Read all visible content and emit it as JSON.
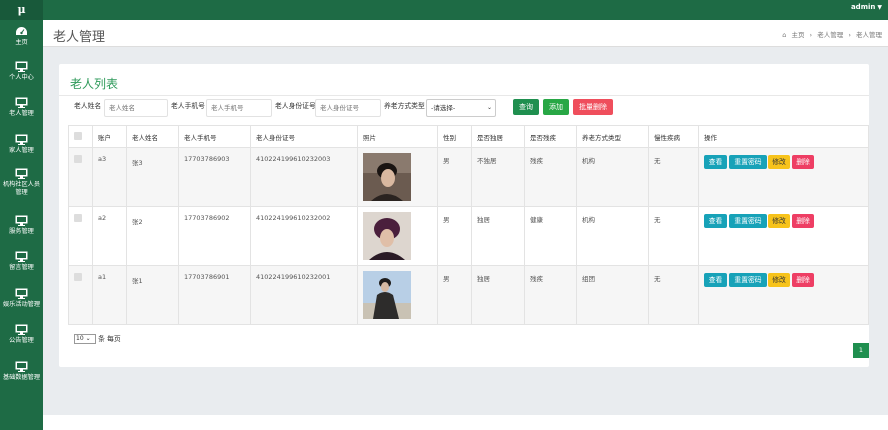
{
  "app": {
    "logo": "μ",
    "user": "admin"
  },
  "sidebar": {
    "items": [
      {
        "label": "主页",
        "icon": "dashboard-icon"
      },
      {
        "label": "个人中心",
        "icon": "monitor-icon"
      },
      {
        "label": "老人管理",
        "icon": "monitor-icon"
      },
      {
        "label": "家人管理",
        "icon": "monitor-icon"
      },
      {
        "label": "机构社区人员管理",
        "icon": "monitor-icon"
      },
      {
        "label": "服务管理",
        "icon": "monitor-icon"
      },
      {
        "label": "留言管理",
        "icon": "monitor-icon"
      },
      {
        "label": "娱乐活动管理",
        "icon": "monitor-icon"
      },
      {
        "label": "公告管理",
        "icon": "monitor-icon"
      },
      {
        "label": "基础数据管理",
        "icon": "monitor-icon"
      }
    ]
  },
  "header": {
    "title": "老人管理",
    "breadcrumb": [
      "主页",
      "老人管理",
      "老人管理"
    ]
  },
  "card": {
    "title": "老人列表"
  },
  "filters": {
    "name_label": "老人姓名",
    "name_placeholder": "老人姓名",
    "phone_label": "老人手机号",
    "phone_placeholder": "老人手机号",
    "id_label": "老人身份证号",
    "id_placeholder": "老人身份证号",
    "care_label": "养老方式类型",
    "care_selected": "-请选择-"
  },
  "buttons": {
    "search": "查询",
    "add": "添加",
    "batch_delete": "批量删除"
  },
  "table": {
    "headers": [
      "账户",
      "老人姓名",
      "老人手机号",
      "老人身份证号",
      "照片",
      "性别",
      "是否独居",
      "是否残疾",
      "养老方式类型",
      "慢性疾病",
      "操作"
    ],
    "rows": [
      {
        "account": "a3",
        "name": "张3",
        "phone": "17703786903",
        "idcard": "410224199610232003",
        "gender": "男",
        "alone": "不独居",
        "disabled": "残疾",
        "care": "机构",
        "chronic": "无"
      },
      {
        "account": "a2",
        "name": "张2",
        "phone": "17703786902",
        "idcard": "410224199610232002",
        "gender": "男",
        "alone": "独居",
        "disabled": "健康",
        "care": "机构",
        "chronic": "无"
      },
      {
        "account": "a1",
        "name": "张1",
        "phone": "17703786901",
        "idcard": "410224199610232001",
        "gender": "男",
        "alone": "独居",
        "disabled": "残疾",
        "care": "组团",
        "chronic": "无"
      }
    ],
    "actions": {
      "view": "查看",
      "reset": "重置密码",
      "edit": "修改",
      "delete": "删除"
    }
  },
  "pagination": {
    "per_page": "10",
    "per_page_suffix": "条 每页",
    "current": "1"
  },
  "colors": {
    "brand": "#1e6b45",
    "accent": "#2e9a5a",
    "danger": "#ef4e5c",
    "info": "#17a2b8",
    "warning": "#f7c31b"
  }
}
